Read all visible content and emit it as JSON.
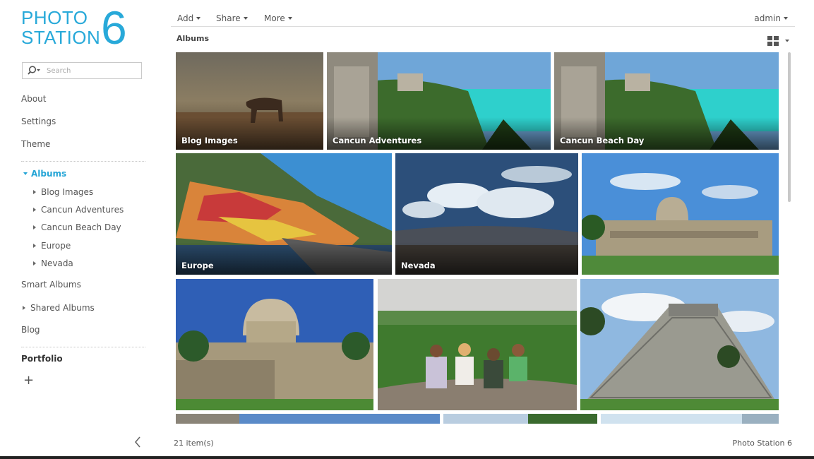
{
  "app": {
    "logo_line1": "PHOTO",
    "logo_line2": "STATION",
    "logo_number": "6",
    "brand_color": "#28a9d9"
  },
  "search": {
    "placeholder": "Search"
  },
  "sidebar": {
    "about": "About",
    "settings": "Settings",
    "theme": "Theme",
    "albums": "Albums",
    "album_items": [
      "Blog Images",
      "Cancun Adventures",
      "Cancun Beach Day",
      "Europe",
      "Nevada"
    ],
    "smart_albums": "Smart Albums",
    "shared_albums": "Shared Albums",
    "blog": "Blog",
    "portfolio": "Portfolio",
    "add_symbol": "+",
    "active_color": "#25a5d6"
  },
  "toolbar": {
    "add": "Add",
    "share": "Share",
    "more": "More",
    "user": "admin"
  },
  "main": {
    "title": "Albums",
    "tiles": [
      {
        "caption": "Blog Images",
        "scene": "horse-field"
      },
      {
        "caption": "Cancun Adventures",
        "scene": "tulum-ruins"
      },
      {
        "caption": "Cancun Beach Day",
        "scene": "tulum-ruins"
      },
      {
        "caption": "Europe",
        "scene": "cinque-terre"
      },
      {
        "caption": "Nevada",
        "scene": "desert-clouds"
      },
      {
        "caption": "",
        "scene": "observatory"
      },
      {
        "caption": "",
        "scene": "observatory-close"
      },
      {
        "caption": "",
        "scene": "jungle-group"
      },
      {
        "caption": "",
        "scene": "pyramid"
      },
      {
        "caption": "",
        "scene": "partial-a"
      },
      {
        "caption": "",
        "scene": "partial-b"
      },
      {
        "caption": "",
        "scene": "partial-c"
      }
    ]
  },
  "footer": {
    "count": "21 item(s)",
    "brand": "Photo Station 6"
  }
}
